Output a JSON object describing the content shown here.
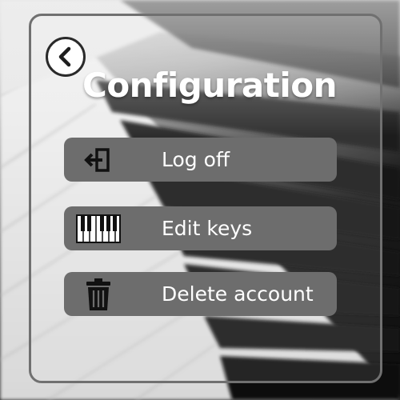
{
  "page": {
    "title": "Configuration"
  },
  "back_button": {
    "icon": "chevron-left-icon"
  },
  "menu": {
    "items": [
      {
        "label": "Log off",
        "icon": "logout-icon"
      },
      {
        "label": "Edit keys",
        "icon": "piano-keys-icon"
      },
      {
        "label": "Delete account",
        "icon": "trash-icon"
      }
    ]
  },
  "colors": {
    "button_fill": "#6d6d6d",
    "frame_border": "#707070",
    "text": "#ffffff"
  }
}
